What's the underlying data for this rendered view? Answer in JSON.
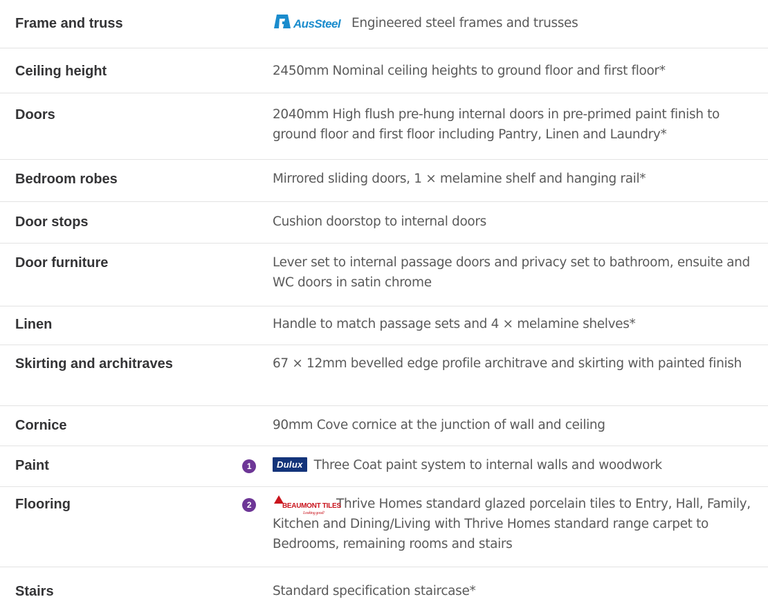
{
  "rows": [
    {
      "label": "Frame and truss",
      "value": "Engineered steel frames and trusses",
      "logo": "AusSteel"
    },
    {
      "label": "Ceiling height",
      "value": "2450mm Nominal ceiling heights to ground floor and first floor*"
    },
    {
      "label": "Doors",
      "value": "2040mm High flush pre-hung internal doors in pre-primed paint finish to ground floor and first floor including Pantry, Linen and Laundry*"
    },
    {
      "label": "Bedroom robes",
      "value": "Mirrored sliding doors, 1 × melamine shelf and hanging rail*"
    },
    {
      "label": "Door stops",
      "value": "Cushion doorstop to internal doors"
    },
    {
      "label": "Door furniture",
      "value": "Lever set to internal passage doors and privacy set to bathroom, ensuite and WC doors in satin chrome"
    },
    {
      "label": "Linen",
      "value": "Handle to match passage sets and 4 × melamine shelves*"
    },
    {
      "label": "Skirting and architraves",
      "value": "67 × 12mm bevelled edge profile architrave and skirting with painted finish"
    },
    {
      "label": "Cornice",
      "value": "90mm Cove cornice at the junction of wall and ceiling"
    },
    {
      "label": "Paint",
      "value": "Three Coat paint system to internal walls and woodwork",
      "badge": "1",
      "logo": "Dulux"
    },
    {
      "label": "Flooring",
      "value": "Thrive Homes standard glazed porcelain tiles to Entry, Hall, Family, Kitchen and Dining/Living with Thrive Homes standard range carpet to Bedrooms, remaining rooms and stairs",
      "badge": "2",
      "logo": "BEAUMONT TILES",
      "logo_tagline": "Looking good!"
    },
    {
      "label": "Stairs",
      "value": "Standard specification staircase*"
    }
  ],
  "colors": {
    "label": "#343436",
    "value": "#5a5a5a",
    "badge": "#6d3696",
    "divider": "#e3e3e3",
    "dulux": "#13347a",
    "beaumont": "#c9141d",
    "aussteel": "#1a8ccd"
  }
}
